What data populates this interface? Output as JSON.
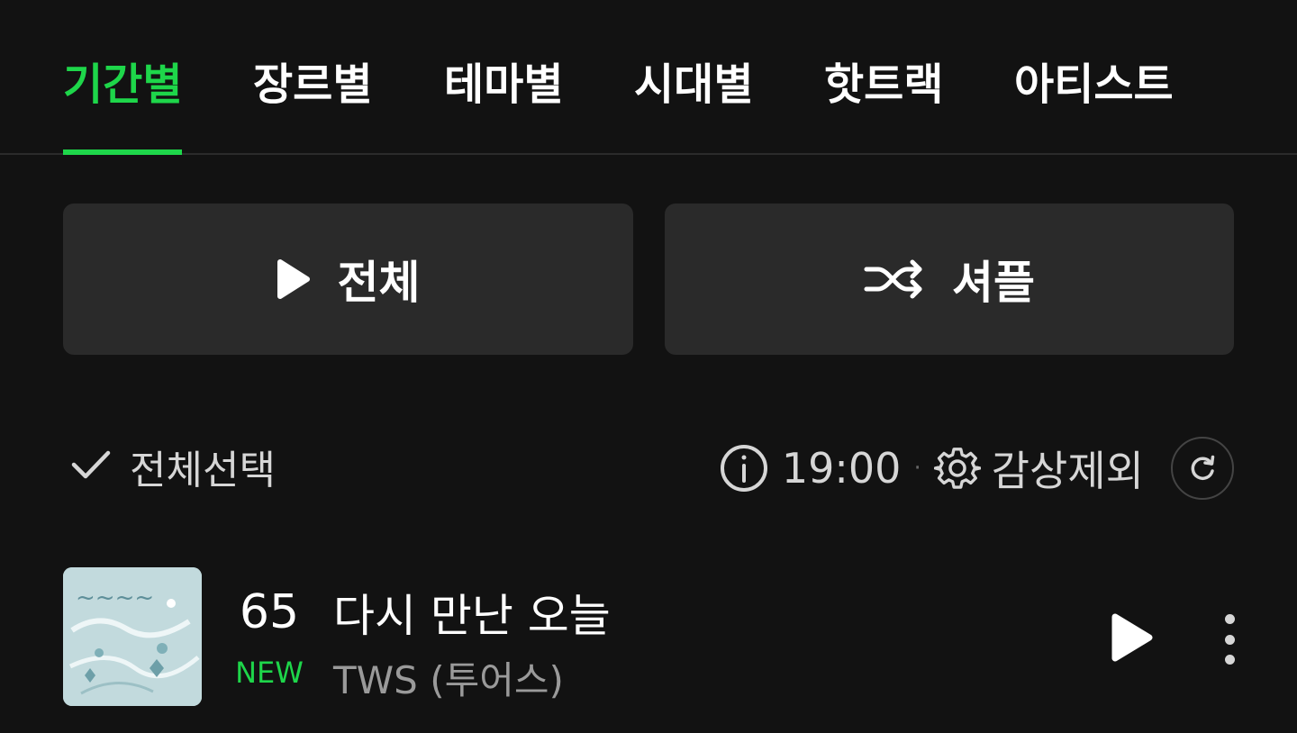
{
  "tabs": [
    {
      "label": "기간별",
      "active": true
    },
    {
      "label": "장르별",
      "active": false
    },
    {
      "label": "테마별",
      "active": false
    },
    {
      "label": "시대별",
      "active": false
    },
    {
      "label": "핫트랙",
      "active": false
    },
    {
      "label": "아티스트",
      "active": false
    }
  ],
  "actions": {
    "play_all_label": "전체",
    "shuffle_label": "셔플"
  },
  "list_controls": {
    "select_all_label": "전체선택",
    "time": "19:00",
    "separator": "·",
    "exclude_label": "감상제외"
  },
  "track": {
    "rank": "65",
    "badge": "NEW",
    "title": "다시 만난 오늘",
    "artist": "TWS (투어스)"
  },
  "colors": {
    "accent": "#1ed64a",
    "background": "#121212",
    "button_bg": "#2a2a2a"
  }
}
